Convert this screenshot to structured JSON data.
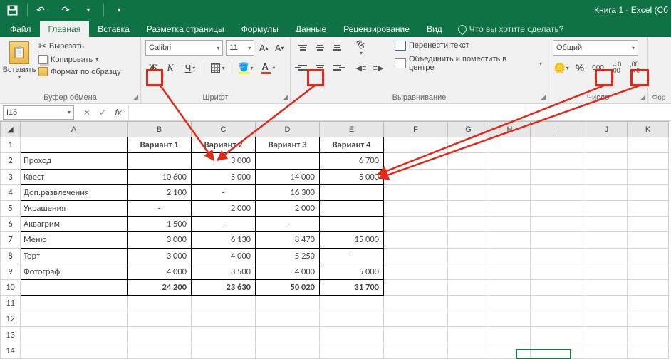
{
  "title": "Книга 1 - Excel (Сб",
  "qat": {
    "save": "💾",
    "undo": "↶",
    "redo": "↷",
    "custom": "▾"
  },
  "tabs": {
    "file": "Файл",
    "home": "Главная",
    "insert": "Вставка",
    "layout": "Разметка страницы",
    "formulas": "Формулы",
    "data": "Данные",
    "review": "Рецензирование",
    "view": "Вид",
    "tellme": "Что вы хотите сделать?"
  },
  "ribbon": {
    "clipboard": {
      "paste": "Вставить",
      "cut": "Вырезать",
      "copy": "Копировать",
      "format_painter": "Формат по образцу",
      "label": "Буфер обмена"
    },
    "font": {
      "name": "Calibri",
      "size": "11",
      "bold": "Ж",
      "italic": "К",
      "underline": "Ч",
      "label": "Шрифт"
    },
    "align": {
      "wrap": "Перенести текст",
      "merge": "Объединить и поместить в центре",
      "label": "Выравнивание"
    },
    "number": {
      "format": "Общий",
      "sep": "000",
      "inc": "←0\n,00",
      "dec": ",00\n→0",
      "label": "Число",
      "for_label": "Фор"
    }
  },
  "namebox": "I15",
  "columns": [
    "A",
    "B",
    "C",
    "D",
    "E",
    "F",
    "G",
    "H",
    "I",
    "J",
    "K"
  ],
  "rows": [
    "1",
    "2",
    "3",
    "4",
    "5",
    "6",
    "7",
    "8",
    "9",
    "10",
    "11",
    "12",
    "13",
    "14"
  ],
  "table": {
    "headers": [
      "Вариант 1",
      "Вариант 2",
      "Вариант 3",
      "Вариант 4"
    ],
    "rows": [
      {
        "label": "Проход",
        "v": [
          "",
          "3 000",
          "",
          "6 700"
        ]
      },
      {
        "label": "Квест",
        "v": [
          "10 600",
          "5 000",
          "14 000",
          "5 000"
        ]
      },
      {
        "label": "Доп.развлечения",
        "v": [
          "2 100",
          "-",
          "16 300",
          ""
        ]
      },
      {
        "label": "Украшения",
        "v": [
          "-",
          "2 000",
          "2 000",
          ""
        ]
      },
      {
        "label": "Аквагрим",
        "v": [
          "1 500",
          "-",
          "-",
          ""
        ]
      },
      {
        "label": "Меню",
        "v": [
          "3 000",
          "6 130",
          "8 470",
          "15 000"
        ]
      },
      {
        "label": "Торт",
        "v": [
          "3 000",
          "4 000",
          "5 250",
          "-"
        ]
      },
      {
        "label": "Фотограф",
        "v": [
          "4 000",
          "3 500",
          "4 000",
          "5 000"
        ]
      }
    ],
    "totals": [
      "24 200",
      "23 630",
      "50 020",
      "31 700"
    ]
  }
}
